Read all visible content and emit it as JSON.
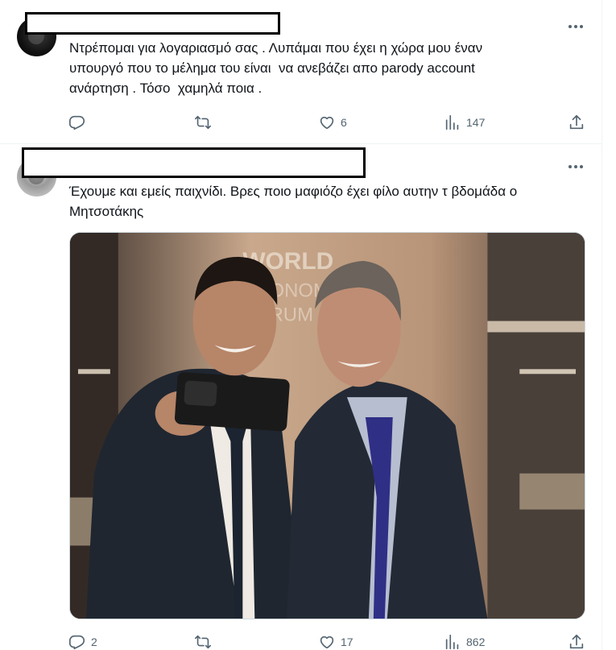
{
  "tweets": [
    {
      "text": "Ντρέπομαι για λογαριασμό σας . Λυπάμαι που έχει η χώρα μου έναν\nυπουργό που το μέλημα του είναι  να ανεβάζει απο parody account\nανάρτηση . Τόσο  χαμηλά ποια .",
      "stats": {
        "replies": "",
        "retweets": "",
        "likes": "6",
        "views": "147"
      }
    },
    {
      "text": "Έχουμε και εμείς παιχνίδι. Βρες ποιο μαφιόζο έχει φίλο αυτην τ βδομάδα ο\nΜητσοτάκης",
      "stats": {
        "replies": "2",
        "retweets": "",
        "likes": "17",
        "views": "862"
      },
      "media": {
        "sign_text": "WORLD ECONOMIC FORUM"
      }
    }
  ],
  "icons": {
    "more": "more-horizontal-icon",
    "reply": "reply-icon",
    "retweet": "retweet-icon",
    "like": "heart-icon",
    "views": "views-icon",
    "share": "share-icon"
  },
  "colors": {
    "text": "#0f1419",
    "muted": "#536471",
    "border": "#eff3f4"
  }
}
